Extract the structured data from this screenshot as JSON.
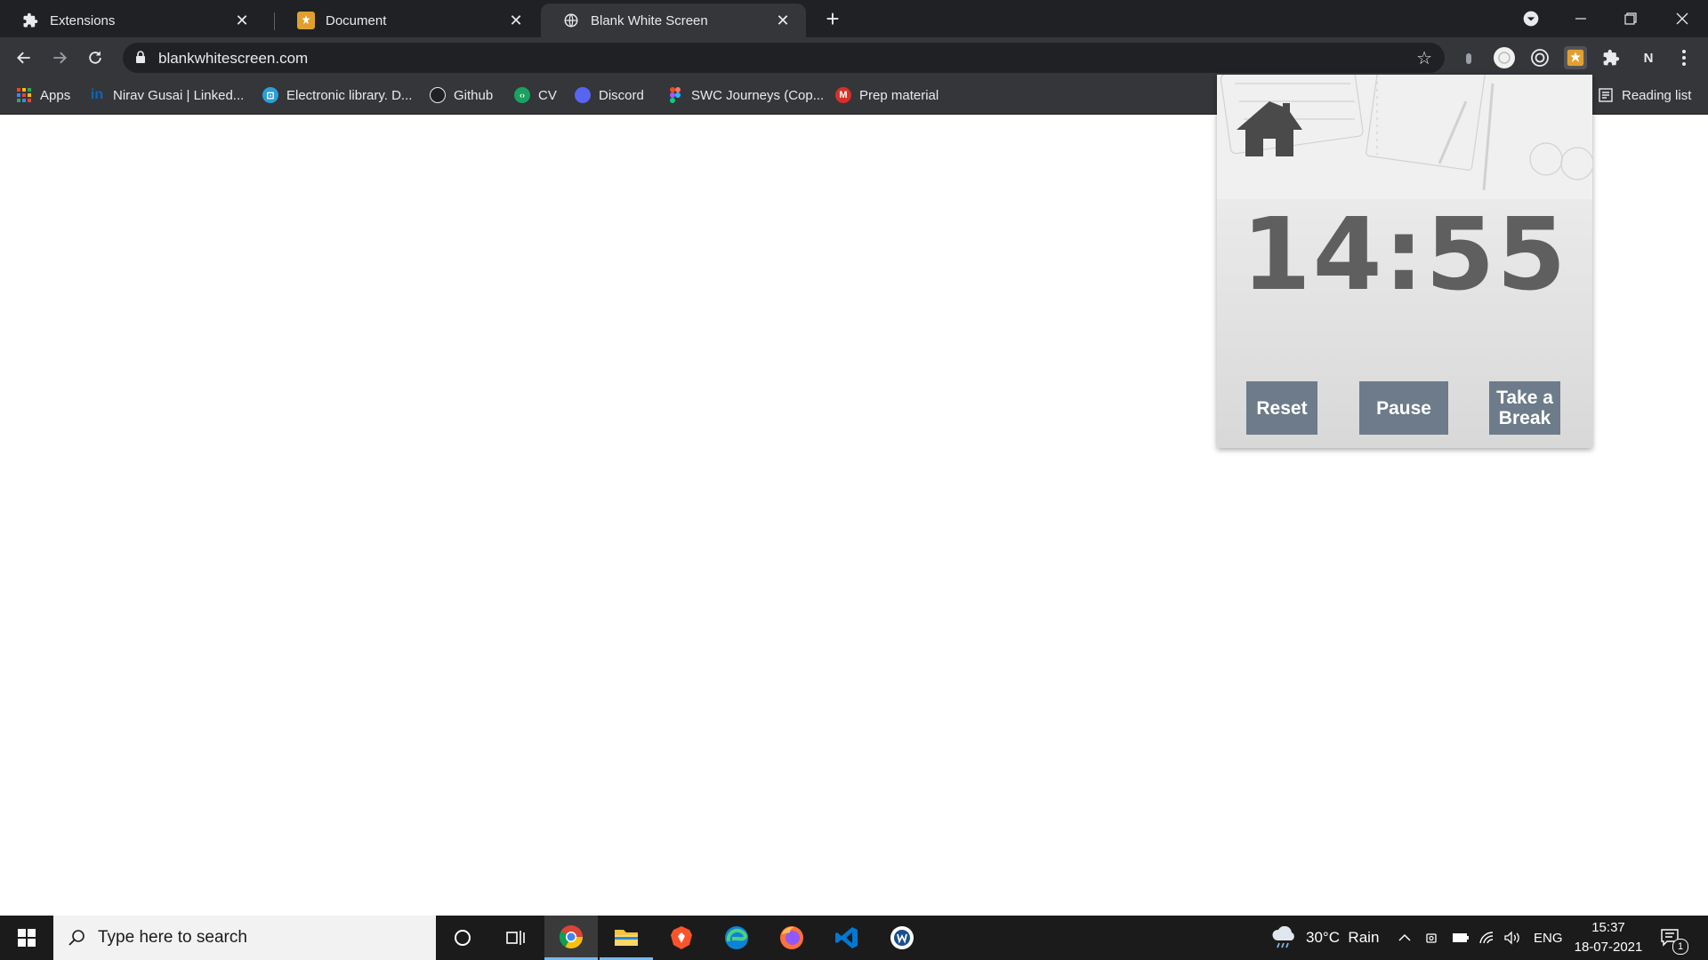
{
  "tabs": [
    {
      "title": "Extensions",
      "icon": "puzzle-icon"
    },
    {
      "title": "Document",
      "icon": "extension-favicon-icon"
    },
    {
      "title": "Blank White Screen",
      "icon": "globe-icon",
      "active": true
    }
  ],
  "address_bar": {
    "url": "blankwhitescreen.com"
  },
  "profile_initial": "N",
  "bookmarks": [
    {
      "label": "Apps",
      "icon": "apps-grid-icon"
    },
    {
      "label": "Nirav Gusai | Linked...",
      "icon": "linkedin-icon"
    },
    {
      "label": "Electronic library. D...",
      "icon": "library-icon"
    },
    {
      "label": "Github",
      "icon": "github-icon"
    },
    {
      "label": "CV",
      "icon": "cv-icon"
    },
    {
      "label": "Discord",
      "icon": "discord-icon"
    },
    {
      "label": "SWC Journeys (Cop...",
      "icon": "figma-icon"
    },
    {
      "label": "Prep material",
      "icon": "gmail-icon"
    }
  ],
  "reading_list": "Reading list",
  "popup": {
    "timer": "14:55",
    "buttons": {
      "reset": "Reset",
      "pause": "Pause",
      "break_line1": "Take a",
      "break_line2": "Break"
    }
  },
  "taskbar": {
    "search_placeholder": "Type here to search",
    "weather": "30°C  Rain",
    "language": "ENG",
    "time": "15:37",
    "date": "18-07-2021",
    "notifications": "1"
  },
  "colors": {
    "accent": "#76b9ed",
    "popup_button": "#6d7b8a",
    "timer_text": "#5f5f5f"
  }
}
